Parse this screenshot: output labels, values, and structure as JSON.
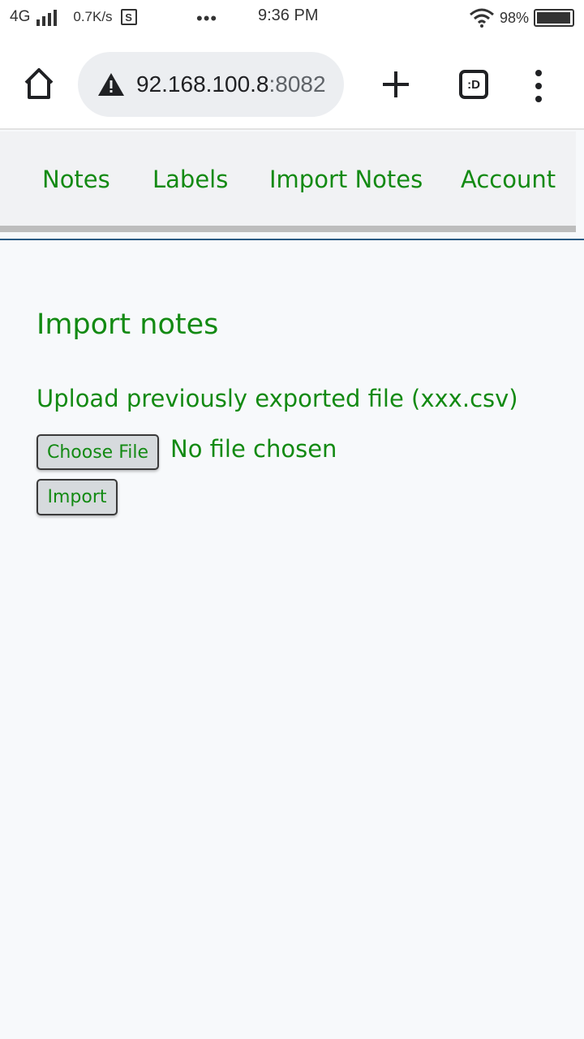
{
  "status_bar": {
    "network": "4G",
    "speed": "0.7K/s",
    "s_icon_label": "S",
    "dots": "•••",
    "time": "9:36 PM",
    "battery_pct": "98%",
    "battery_level": 0.98
  },
  "browser": {
    "url_host": "92.168.100.8",
    "url_port": ":8082",
    "tabs_label": ":D"
  },
  "nav": {
    "notes": "Notes",
    "labels": "Labels",
    "import_notes": "Import Notes",
    "account": "Account"
  },
  "main": {
    "title": "Import notes",
    "upload_label": "Upload previously exported file (xxx.csv)",
    "choose_file_label": "Choose File",
    "file_status": "No file chosen",
    "import_label": "Import"
  }
}
